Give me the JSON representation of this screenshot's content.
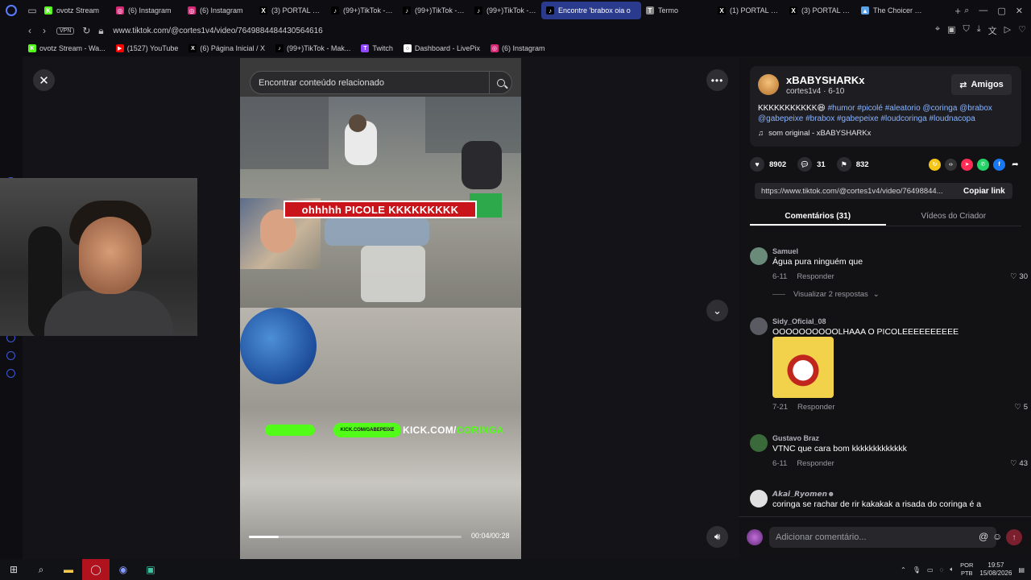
{
  "browser": {
    "tabs": [
      {
        "label": "ovotz Stream",
        "color": "#53fc18",
        "glyph": "K",
        "active": false
      },
      {
        "label": "(6) Instagram",
        "color": "#d62976",
        "glyph": "◎",
        "active": false
      },
      {
        "label": "(6) Instagram",
        "color": "#d62976",
        "glyph": "◎",
        "active": false
      },
      {
        "label": "(3) PORTAL INSI",
        "color": "#000000",
        "glyph": "X",
        "active": false
      },
      {
        "label": "(99+)TikTok - M",
        "color": "#000000",
        "glyph": "♪",
        "active": false
      },
      {
        "label": "(99+)TikTok - M",
        "color": "#000000",
        "glyph": "♪",
        "active": false
      },
      {
        "label": "(99+)TikTok - M",
        "color": "#000000",
        "glyph": "♪",
        "active": false
      },
      {
        "label": "Encontre 'brabox oia o",
        "color": "#000000",
        "glyph": "♪",
        "active": true
      },
      {
        "label": "Termo",
        "color": "#888888",
        "glyph": "T",
        "active": false
      },
      {
        "label": "(1) PORTAL INSI",
        "color": "#000000",
        "glyph": "X",
        "active": false
      },
      {
        "label": "(3) PORTAL INSI",
        "color": "#000000",
        "glyph": "X",
        "active": false
      },
      {
        "label": "The Choicer Voic",
        "color": "#5aa0e6",
        "glyph": "▲",
        "active": false
      }
    ],
    "url": "www.tiktok.com/@cortes1v4/video/7649884484430564616",
    "vpn_label": "VPN",
    "bookmarks": [
      {
        "label": "ovotz Stream - Wa...",
        "color": "#53fc18",
        "glyph": "K"
      },
      {
        "label": "(1527) YouTube",
        "color": "#ff0000",
        "glyph": "▶"
      },
      {
        "label": "(6) Página Inicial / X",
        "color": "#000000",
        "glyph": "X"
      },
      {
        "label": "(99+)TikTok - Mak...",
        "color": "#000000",
        "glyph": "♪"
      },
      {
        "label": "Twitch",
        "color": "#9146ff",
        "glyph": "T"
      },
      {
        "label": "Dashboard - LivePix",
        "color": "#ffffff",
        "glyph": "○"
      },
      {
        "label": "(6) Instagram",
        "color": "#d62976",
        "glyph": "◎"
      }
    ]
  },
  "player": {
    "search_placeholder": "Encontrar conteúdo relacionado",
    "caption": "ohhhhh PICOLE KKKKKKKKK",
    "kick_badge": "KICK.COM/GABEPEIXE",
    "kick_prefix": "KICK.COM/",
    "kick_suffix": "CORINGA",
    "progress": 0.14,
    "time": "00:04/00:28"
  },
  "post": {
    "author": "xBABYSHARKx",
    "meta": "cortes1v4 · 6-10",
    "friends_label": "Amigos",
    "desc_text": "KKKKKKKKKKK😆 ",
    "desc_tags": "#humor #picolé #aleatorio @coringa @brabox @gabepeixe #brabox #gabepeixe #loudcoringa #loudnacopa",
    "sound": "som original - xBABYSHARKx",
    "likes": "8902",
    "comments_count": "31",
    "saves": "832",
    "link": "https://www.tiktok.com/@cortes1v4/video/76498844...",
    "copy_label": "Copiar link",
    "tab_comments": "Comentários (31)",
    "tab_creator": "Vídeos do Criador"
  },
  "comments": [
    {
      "user": "Samuel",
      "text": "Água pura ninguém que",
      "date": "6-11",
      "reply": "Responder",
      "likes": "30",
      "replies": "Visualizar 2 respostas",
      "color": "#6a8a7a"
    },
    {
      "user": "Sidy_Oficial_08",
      "text": "OOOOOOOOOOLHAAA O PICOLEEEEEEEEEE",
      "date": "7-21",
      "reply": "Responder",
      "likes": "5",
      "color": "#5a5a62"
    },
    {
      "user": "Gustavo Braz",
      "text": "VTNC que cara bom kkkkkkkkkkkkk",
      "date": "6-11",
      "reply": "Responder",
      "likes": "43",
      "color": "#3a6a3a"
    },
    {
      "user": "𝘼𝙠𝙖𝙞_𝙍𝙮𝙤𝙢𝙚𝙣☻",
      "text": "coringa se rachar de rir kakakak a risada do coringa é a",
      "color": "#e0e0e0"
    }
  ],
  "comment_input": {
    "placeholder": "Adicionar comentário..."
  },
  "taskbar": {
    "lang1": "POR",
    "lang2": "PTB",
    "time": "19:57",
    "date": "15/08/2026"
  }
}
